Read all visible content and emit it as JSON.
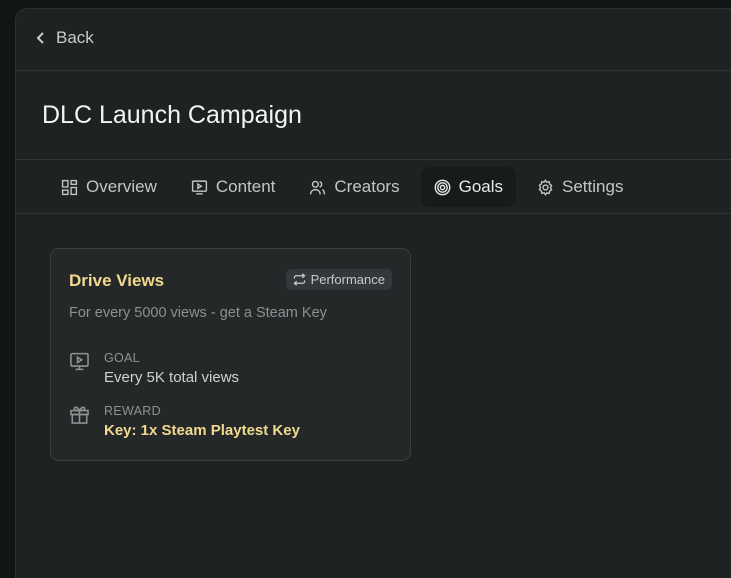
{
  "nav": {
    "back_label": "Back"
  },
  "page": {
    "title": "DLC Launch Campaign"
  },
  "tabs": [
    {
      "label": "Overview"
    },
    {
      "label": "Content"
    },
    {
      "label": "Creators"
    },
    {
      "label": "Goals",
      "active": true
    },
    {
      "label": "Settings"
    }
  ],
  "goal_card": {
    "title": "Drive Views",
    "badge": "Performance",
    "description": "For every 5000 views - get a Steam Key",
    "goal_label": "GOAL",
    "goal_value": "Every 5K total views",
    "reward_label": "REWARD",
    "reward_value": "Key: 1x Steam Playtest Key"
  },
  "colors": {
    "accent": "#f1d98d",
    "background": "#1f2223"
  }
}
